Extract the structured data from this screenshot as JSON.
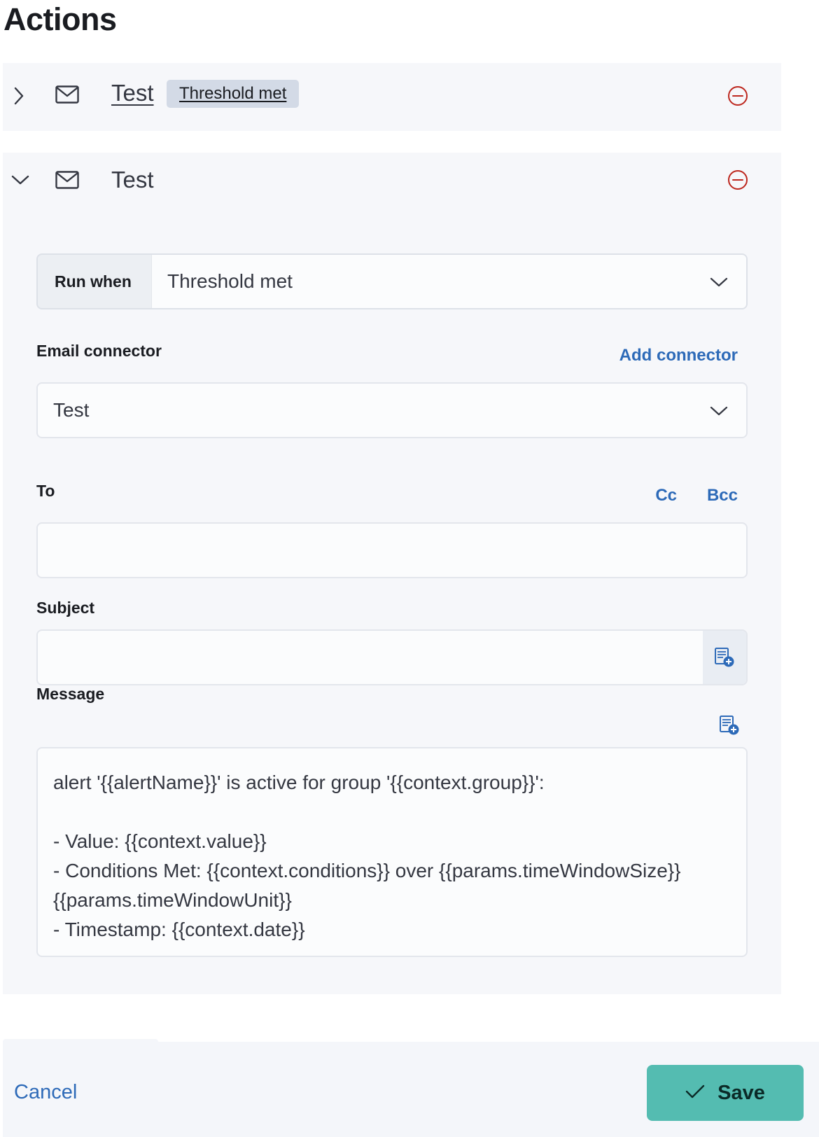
{
  "page": {
    "title": "Actions"
  },
  "actions": [
    {
      "expanded": false,
      "title": "Test",
      "badge": "Threshold met",
      "icons": {
        "toggle": "chevron-right-icon",
        "type": "mail-icon",
        "remove": "minus-in-circle-icon"
      }
    },
    {
      "expanded": true,
      "title": "Test",
      "icons": {
        "toggle": "chevron-down-icon",
        "type": "mail-icon",
        "remove": "minus-in-circle-icon"
      },
      "run_when": {
        "label": "Run when",
        "value": "Threshold met"
      },
      "email_connector": {
        "label": "Email connector",
        "add_link": "Add connector",
        "value": "Test"
      },
      "to": {
        "label": "To",
        "cc_link": "Cc",
        "bcc_link": "Bcc",
        "value": ""
      },
      "subject": {
        "label": "Subject",
        "value": "",
        "add_variable_icon": "add-variable-icon"
      },
      "message": {
        "label": "Message",
        "add_variable_icon": "add-variable-icon",
        "value": "alert '{{alertName}}' is active for group '{{context.group}}':\n\n- Value: {{context.value}}\n- Conditions Met: {{context.conditions}} over {{params.timeWindowSize}}\n{{params.timeWindowUnit}}\n- Timestamp: {{context.date}}"
      }
    }
  ],
  "footer": {
    "cancel_label": "Cancel",
    "save_label": "Save",
    "save_icon": "check-icon"
  },
  "colors": {
    "accent": "#2d6ab8",
    "danger": "#bd271e",
    "save": "#54bcb1",
    "panel": "#f6f7fa"
  }
}
